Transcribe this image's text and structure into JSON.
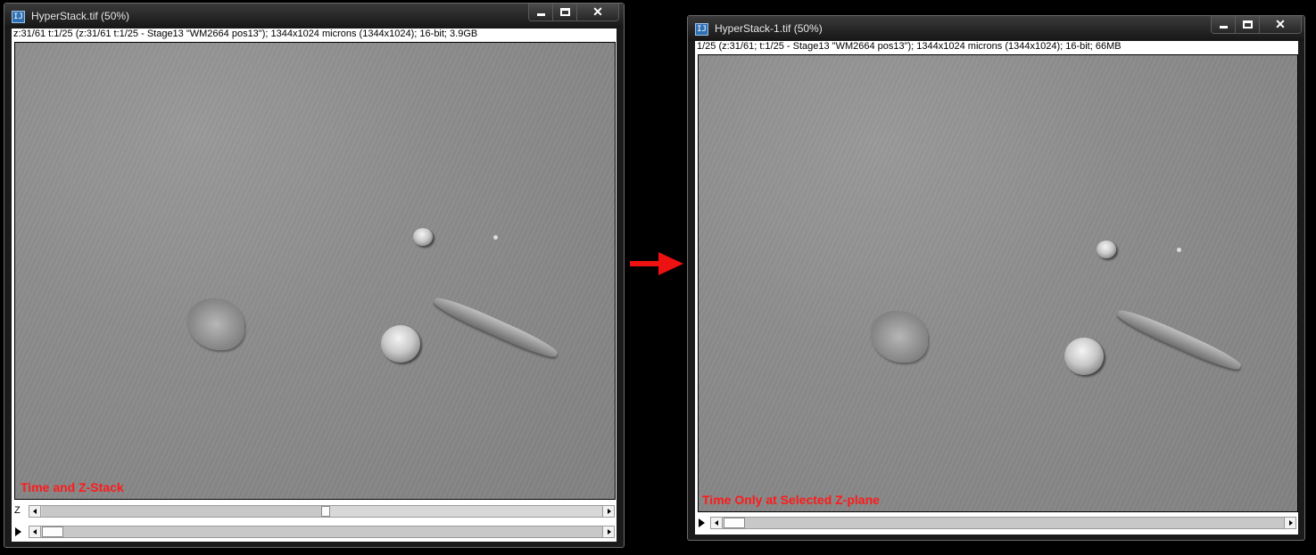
{
  "windows": [
    {
      "title": "HyperStack.tif (50%)",
      "info": "z:31/61 t:1/25 (z:31/61  t:1/25 - Stage13 \"WM2664 pos13\"); 1344x1024 microns (1344x1024); 16-bit; 3.9GB",
      "overlay": "Time and Z-Stack",
      "z_label": "Z",
      "z_position": 0.5,
      "t_position": 0.0
    },
    {
      "title": "HyperStack-1.tif (50%)",
      "info": "1/25 (z:31/61; t:1/25 - Stage13 \"WM2664 pos13\"); 1344x1024 microns (1344x1024); 16-bit; 66MB",
      "overlay": "Time Only at Selected Z-plane",
      "t_position": 0.0
    }
  ],
  "icons": {
    "app": "imagej-icon",
    "minimize": "minimize-icon",
    "maximize": "maximize-icon",
    "close": "close-icon",
    "play": "play-icon",
    "arrow": "red-right-arrow"
  },
  "colors": {
    "overlay_text": "#ff1a1a",
    "arrow": "#ee1111"
  },
  "caption": {
    "close_glyph": "✕",
    "app_glyph": "IJ"
  }
}
